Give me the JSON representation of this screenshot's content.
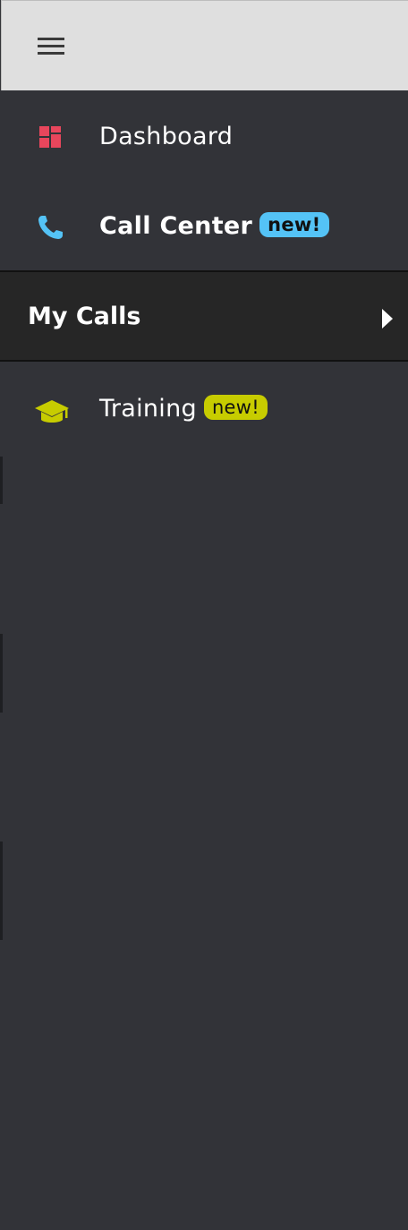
{
  "nav": {
    "items": [
      {
        "label": "Dashboard",
        "icon": "dashboard-icon",
        "icon_color": "#e8465c"
      },
      {
        "label": "Call Center",
        "badge": "new!",
        "icon": "phone-icon",
        "icon_color": "#54c3f6",
        "badge_color": "#54c3f6"
      },
      {
        "label": "My Calls",
        "icon": "chevron-right-icon"
      },
      {
        "label": "Training",
        "badge": "new!",
        "icon": "graduation-cap-icon",
        "icon_color": "#c7cc00",
        "badge_color": "#c7cc00"
      }
    ]
  },
  "colors": {
    "background": "#323338",
    "topbar": "#dfdfdf",
    "selected_row": "#262626"
  }
}
